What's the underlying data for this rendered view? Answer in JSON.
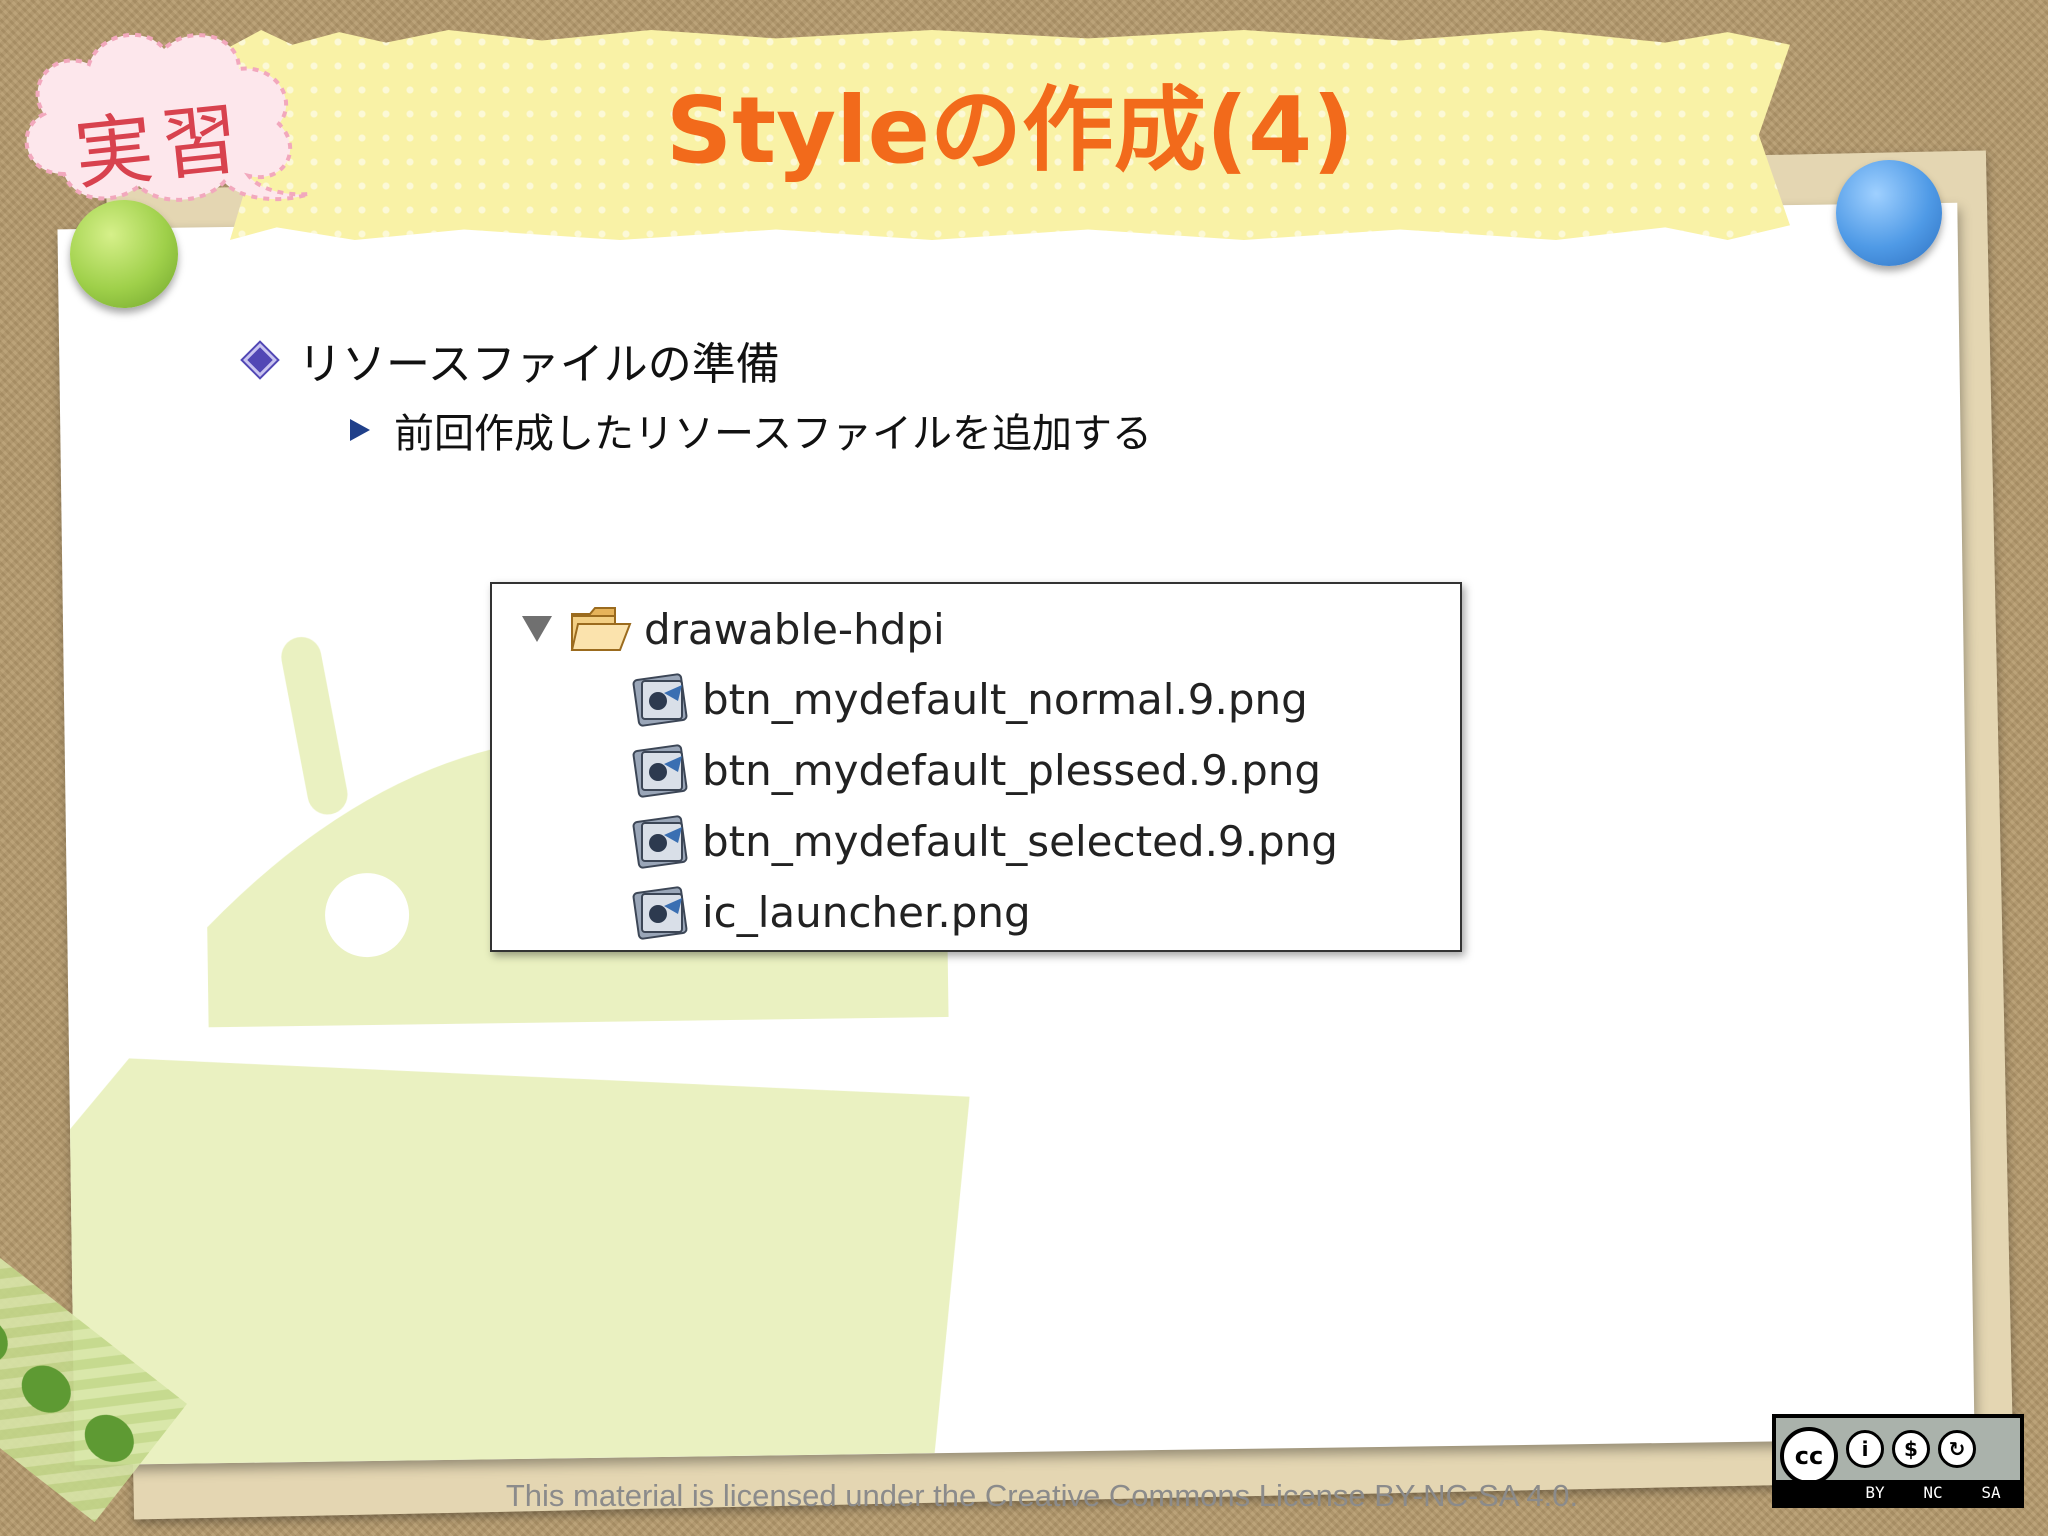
{
  "slide": {
    "badge": "実習",
    "title": "Styleの作成(4)",
    "bullets": [
      {
        "text": "リソースファイルの準備",
        "sub": [
          "前回作成したリソースファイルを追加する"
        ]
      }
    ]
  },
  "file_tree": {
    "folder": "drawable-hdpi",
    "files": [
      "btn_mydefault_normal.9.png",
      "btn_mydefault_plessed.9.png",
      "btn_mydefault_selected.9.png",
      "ic_launcher.png"
    ]
  },
  "footer": {
    "license_text": "This material is licensed under the Creative Commons License BY-NC-SA 4.0.",
    "badge_labels": [
      "BY",
      "NC",
      "SA"
    ],
    "badge_cc": "cc"
  }
}
